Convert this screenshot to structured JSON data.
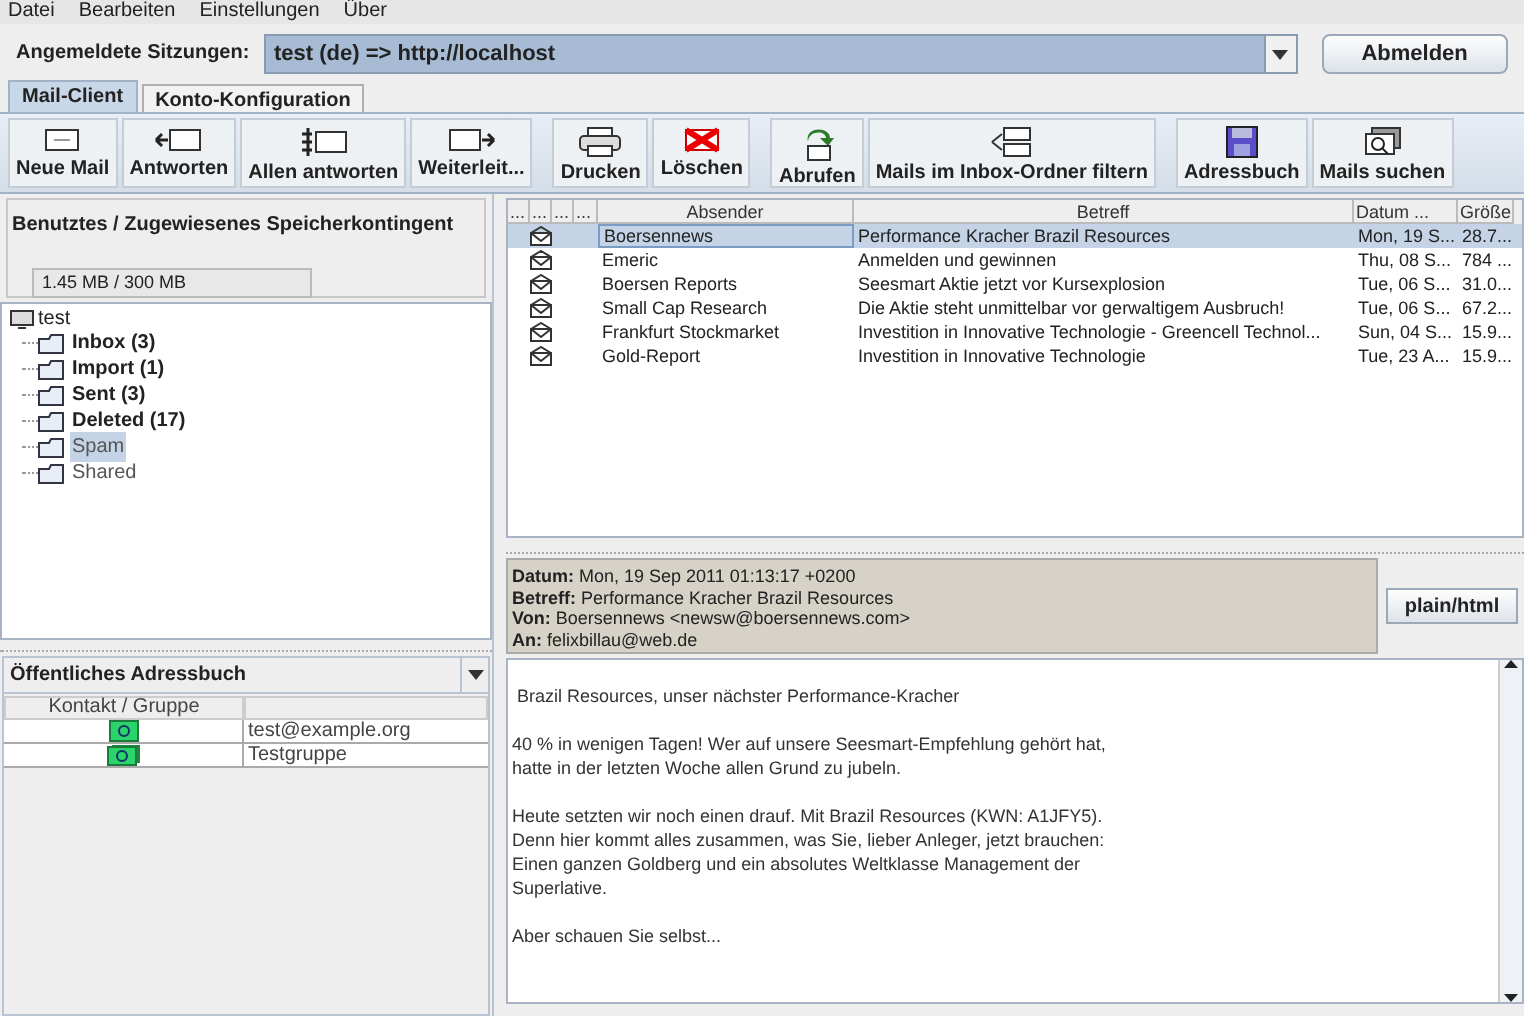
{
  "menu": [
    "Datei",
    "Bearbeiten",
    "Einstellungen",
    "Über"
  ],
  "session": {
    "label": "Angemeldete Sitzungen:",
    "value": "test (de) => http://localhost",
    "button": "Abmelden"
  },
  "tabs": [
    {
      "label": "Mail-Client",
      "selected": true
    },
    {
      "label": "Konto-Konfiguration",
      "selected": false
    }
  ],
  "toolbar": [
    [
      {
        "label": "Neue Mail",
        "kind": "new"
      },
      {
        "label": "Antworten",
        "kind": "reply"
      },
      {
        "label": "Allen antworten",
        "kind": "replyall"
      },
      {
        "label": "Weiterleit...",
        "kind": "forward"
      }
    ],
    [
      {
        "label": "Drucken",
        "kind": "print"
      },
      {
        "label": "Löschen",
        "kind": "delete"
      }
    ],
    [
      {
        "label": "Abrufen",
        "kind": "fetch"
      },
      {
        "label": "Mails im Inbox-Ordner filtern",
        "kind": "filter"
      }
    ],
    [
      {
        "label": "Adressbuch",
        "kind": "addressbook"
      },
      {
        "label": "Mails suchen",
        "kind": "search"
      }
    ]
  ],
  "quota": {
    "title": "Benutztes / Zugewiesenes Speicherkontingent",
    "value": "1.45 MB / 300 MB"
  },
  "folders": {
    "label": "test",
    "children": [
      {
        "label": "Inbox (3)",
        "bold": true,
        "selected": false
      },
      {
        "label": "Import (1)",
        "bold": true,
        "selected": false
      },
      {
        "label": "Sent (3)",
        "bold": true,
        "selected": false
      },
      {
        "label": "Deleted (17)",
        "bold": true,
        "selected": false
      },
      {
        "label": "Spam",
        "bold": false,
        "selected": true
      },
      {
        "label": "Shared",
        "bold": false,
        "selected": false
      }
    ]
  },
  "addressbook": {
    "selector": "Öffentliches Adressbuch",
    "column": "Kontakt / Gruppe",
    "rows": [
      {
        "name": "test@example.org",
        "kind": "contact"
      },
      {
        "name": "Testgruppe",
        "kind": "group"
      }
    ]
  },
  "mail_table": {
    "columns": [
      "...",
      "...",
      "...",
      "...",
      "Absender",
      "Betreff",
      "Datum ...",
      "Größe"
    ],
    "rows": [
      {
        "sender": "Boersennews",
        "subject": "Performance Kracher Brazil Resources",
        "date": "Mon, 19 S...",
        "size": "28.7...",
        "selected": true
      },
      {
        "sender": "Emeric",
        "subject": "Anmelden und gewinnen",
        "date": "Thu, 08 S...",
        "size": "784 ...",
        "selected": false
      },
      {
        "sender": "Boersen Reports",
        "subject": "Seesmart Aktie jetzt vor Kursexplosion",
        "date": "Tue, 06 S...",
        "size": "31.0...",
        "selected": false
      },
      {
        "sender": "Small Cap Research",
        "subject": "Die Aktie steht unmittelbar vor gerwaltigem Ausbruch!",
        "date": "Tue, 06 S...",
        "size": "67.2...",
        "selected": false
      },
      {
        "sender": "Frankfurt Stockmarket",
        "subject": "Investition in Innovative Technologie - Greencell Technol...",
        "date": "Sun, 04 S...",
        "size": "15.9...",
        "selected": false
      },
      {
        "sender": "Gold-Report",
        "subject": "Investition in Innovative Technologie",
        "date": "Tue, 23 A...",
        "size": "15.9...",
        "selected": false
      }
    ]
  },
  "preview": {
    "headers": [
      "**Datum:** Mon, 19 Sep 2011 01:13:17 +0200",
      "**Betreff:** Performance Kracher Brazil Resources",
      "**Von:** Boersennews <newsw@boersennews.com>",
      "**An:** felixbillau@web.de"
    ],
    "format_button": "plain/html",
    "body": [
      " Brazil Resources, unser nächster Performance-Kracher",
      "40 % in wenigen Tagen! Wer auf unsere Seesmart-Empfehlung gehört hat,\nhatte in der letzten Woche allen Grund zu jubeln.",
      "Heute setzten wir noch einen drauf. Mit Brazil Resources (KWN: A1JFY5).\nDenn hier kommt alles zusammen, was Sie, lieber Anleger, jetzt brauchen:\nEinen ganzen Goldberg und ein absolutes Weltklasse Management der\nSuperlative.",
      "Aber schauen Sie selbst..."
    ]
  }
}
